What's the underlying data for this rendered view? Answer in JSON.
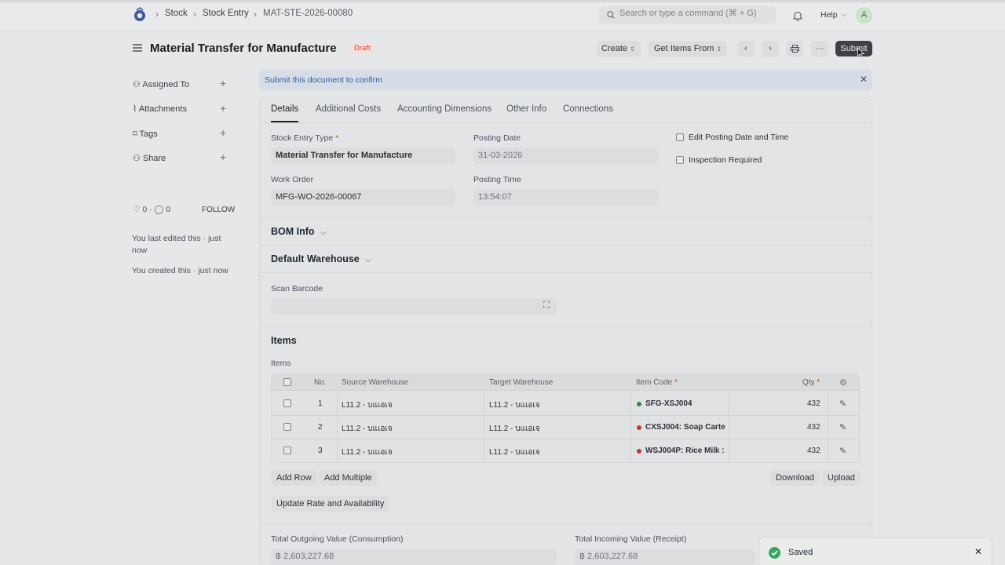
{
  "navbar": {
    "breadcrumbs": [
      "Stock",
      "Stock Entry",
      "MAT-STE-2026-00080"
    ],
    "search_placeholder": "Search or type a command (⌘ + G)",
    "help_label": "Help",
    "avatar_initial": "A"
  },
  "page": {
    "title": "Material Transfer for Manufacture",
    "status_badge": "Draft",
    "create_label": "Create",
    "get_items_label": "Get Items From",
    "submit_label": "Submit"
  },
  "sidebar": {
    "items": [
      {
        "label": "Assigned To"
      },
      {
        "label": "Attachments"
      },
      {
        "label": "Tags"
      },
      {
        "label": "Share"
      }
    ],
    "likes": "0",
    "comments": "0",
    "follow_label": "FOLLOW",
    "last_edited": "You last edited this · just now",
    "created": "You created this · just now"
  },
  "alert": {
    "message": "Submit this document to confirm"
  },
  "tabs": [
    "Details",
    "Additional Costs",
    "Accounting Dimensions",
    "Other Info",
    "Connections"
  ],
  "details": {
    "stock_entry_type_label": "Stock Entry Type",
    "stock_entry_type_value": "Material Transfer for Manufacture",
    "posting_date_label": "Posting Date",
    "posting_date_value": "31-03-2026",
    "work_order_label": "Work Order",
    "work_order_value": "MFG-WO-2026-00067",
    "posting_time_label": "Posting Time",
    "posting_time_value": "13:54:07",
    "edit_posting_label": "Edit Posting Date and Time",
    "inspection_label": "Inspection Required"
  },
  "sections": {
    "bom_info": "BOM Info",
    "default_warehouse": "Default Warehouse",
    "scan_barcode_label": "Scan Barcode",
    "items_title": "Items",
    "items_label": "Items"
  },
  "items_table": {
    "headers": {
      "no": "No.",
      "source": "Source Warehouse",
      "target": "Target Warehouse",
      "item_code": "Item Code",
      "qty": "Qty"
    },
    "rows": [
      {
        "no": "1",
        "source": "L11.2 - บแเอเจ",
        "target": "L11.2 - บแเอเจ",
        "item_code": "SFG-XSJ004",
        "dot_color": "#2e8b4a",
        "qty": "432"
      },
      {
        "no": "2",
        "source": "L11.2 - บแเอเจ",
        "target": "L11.2 - บแเอเจ",
        "item_code": "CXSJ004: Soap Carte",
        "dot_color": "#c0392b",
        "qty": "432"
      },
      {
        "no": "3",
        "source": "L11.2 - บแเอเจ",
        "target": "L11.2 - บแเอเจ",
        "item_code": "WSJ004P: Rice Milk :",
        "dot_color": "#c0392b",
        "qty": "432"
      }
    ],
    "add_row_label": "Add Row",
    "add_multiple_label": "Add Multiple",
    "download_label": "Download",
    "upload_label": "Upload",
    "update_rate_label": "Update Rate and Availability"
  },
  "totals": {
    "outgoing_label": "Total Outgoing Value (Consumption)",
    "outgoing_value": "฿ 2,603,227.68",
    "incoming_label": "Total Incoming Value (Receipt)",
    "incoming_value": "฿ 2,603,227.68"
  },
  "toast": {
    "message": "Saved"
  }
}
